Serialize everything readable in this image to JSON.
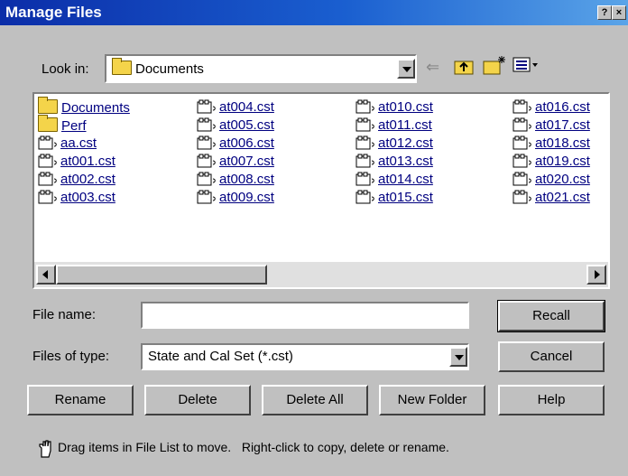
{
  "window": {
    "title": "Manage Files",
    "help_glyph": "?",
    "close_glyph": "×"
  },
  "look_in": {
    "label": "Look in:",
    "value": "Documents"
  },
  "files": [
    {
      "name": "Documents",
      "type": "folder"
    },
    {
      "name": "Perf",
      "type": "folder"
    },
    {
      "name": "aa.cst",
      "type": "file"
    },
    {
      "name": "at001.cst",
      "type": "file"
    },
    {
      "name": "at002.cst",
      "type": "file"
    },
    {
      "name": "at003.cst",
      "type": "file"
    },
    {
      "name": "at004.cst",
      "type": "file"
    },
    {
      "name": "at005.cst",
      "type": "file"
    },
    {
      "name": "at006.cst",
      "type": "file"
    },
    {
      "name": "at007.cst",
      "type": "file"
    },
    {
      "name": "at008.cst",
      "type": "file"
    },
    {
      "name": "at009.cst",
      "type": "file"
    },
    {
      "name": "at010.cst",
      "type": "file"
    },
    {
      "name": "at011.cst",
      "type": "file"
    },
    {
      "name": "at012.cst",
      "type": "file"
    },
    {
      "name": "at013.cst",
      "type": "file"
    },
    {
      "name": "at014.cst",
      "type": "file"
    },
    {
      "name": "at015.cst",
      "type": "file"
    },
    {
      "name": "at016.cst",
      "type": "file"
    },
    {
      "name": "at017.cst",
      "type": "file"
    },
    {
      "name": "at018.cst",
      "type": "file"
    },
    {
      "name": "at019.cst",
      "type": "file"
    },
    {
      "name": "at020.cst",
      "type": "file"
    },
    {
      "name": "at021.cst",
      "type": "file"
    }
  ],
  "file_name": {
    "label": "File name:",
    "value": ""
  },
  "files_of_type": {
    "label": "Files of type:",
    "value": "State and Cal Set (*.cst)"
  },
  "buttons": {
    "recall": "Recall",
    "cancel": "Cancel",
    "rename": "Rename",
    "delete": "Delete",
    "delete_all": "Delete All",
    "new_folder": "New Folder",
    "help": "Help"
  },
  "hint": "Drag items in File List to move.   Right-click to copy, delete or rename.",
  "colors": {
    "title_bar": "#0b2da8",
    "dialog_face": "#c0c0c0",
    "link_text": "#000080"
  }
}
